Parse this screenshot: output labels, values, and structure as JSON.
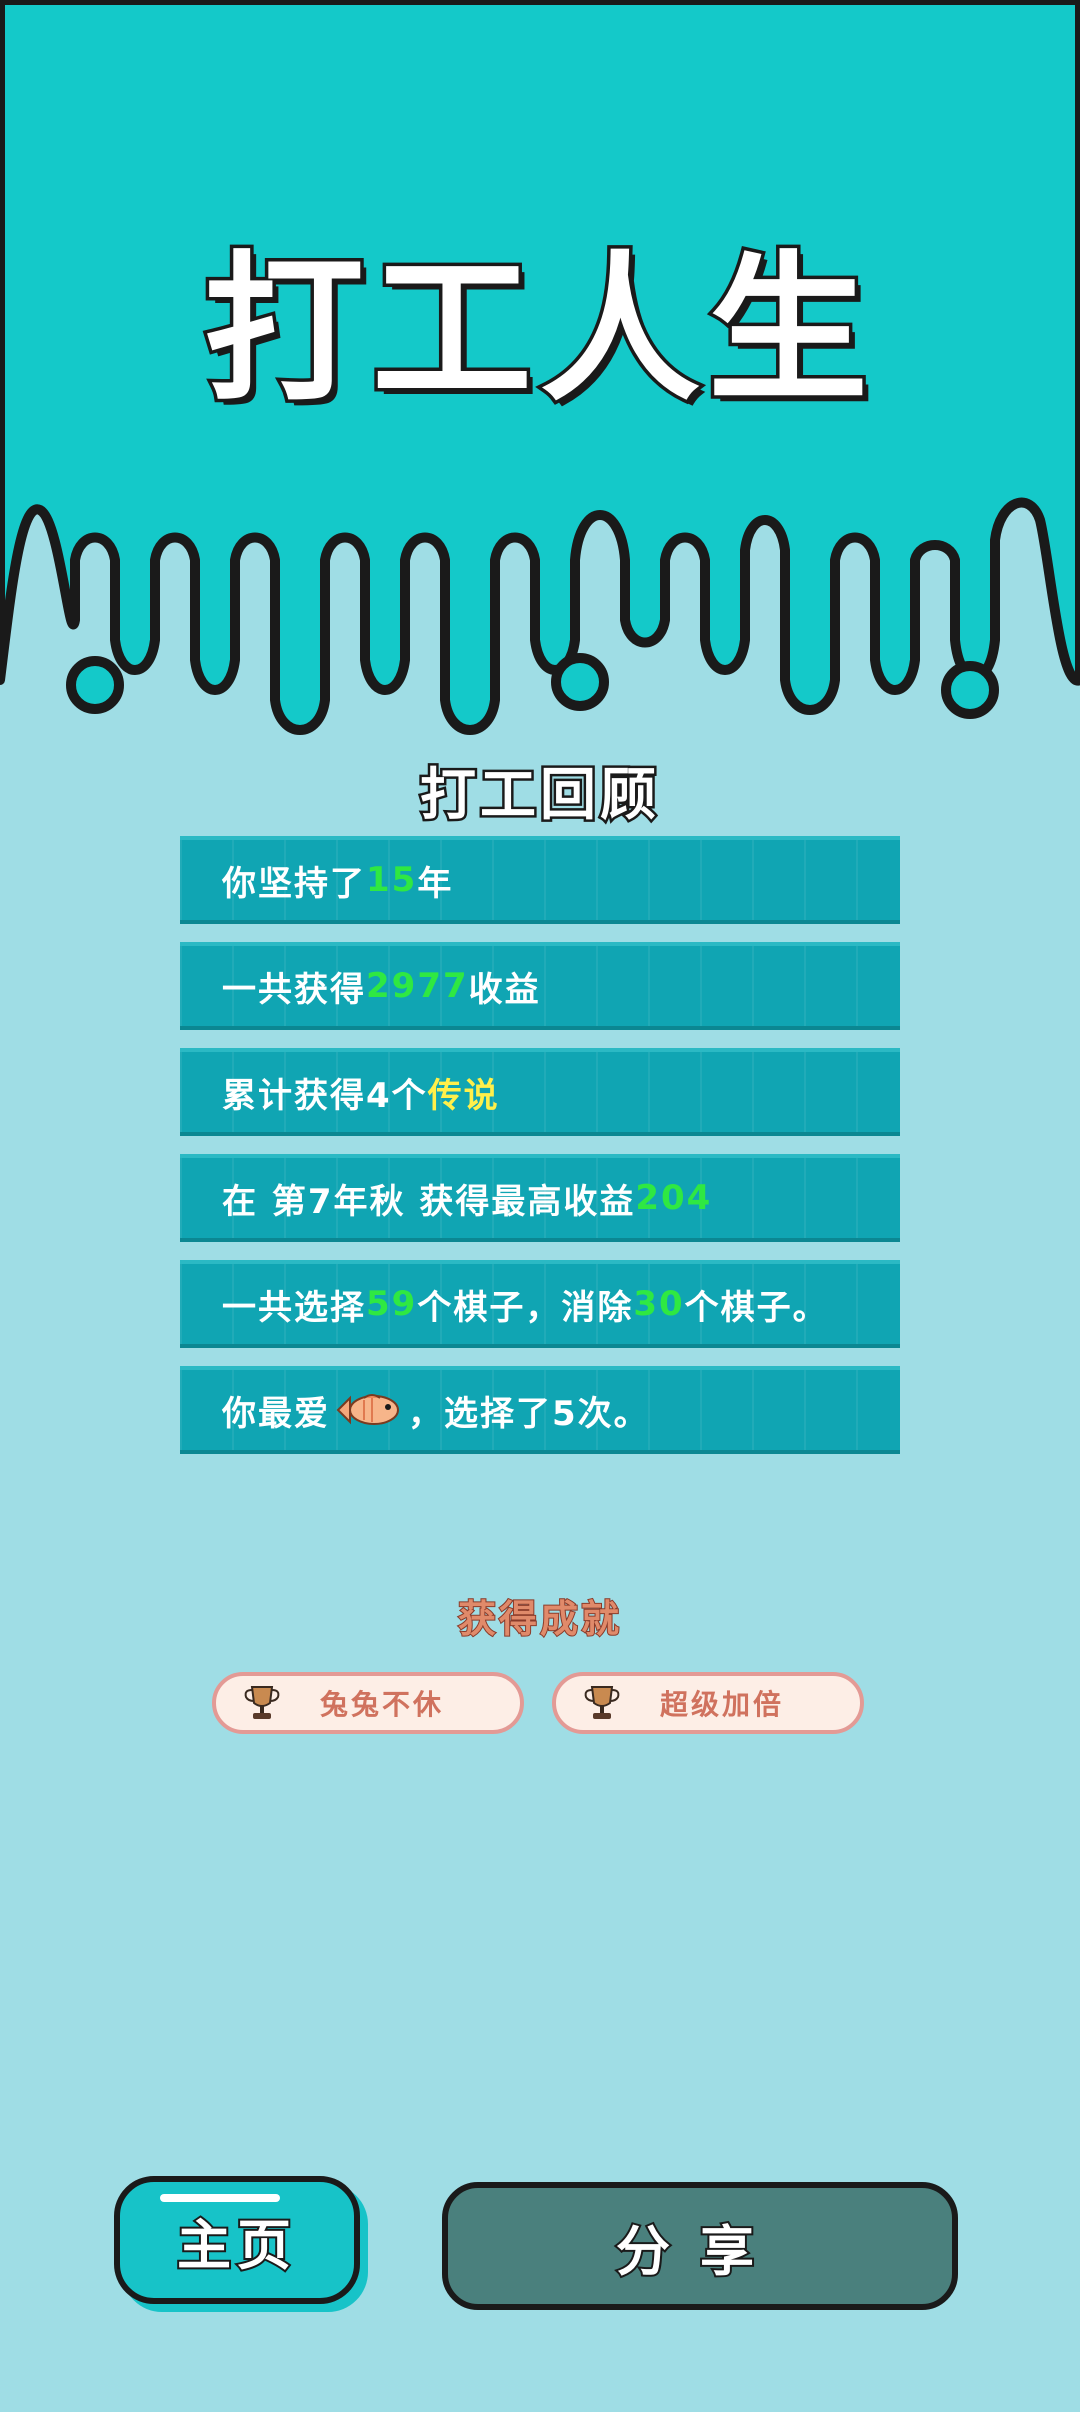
{
  "colors": {
    "top_bg": "#14c9c9",
    "page_bg": "#9fdde5",
    "row_bg": "#10a5b3",
    "highlight_green": "#2fe842",
    "highlight_yellow": "#fff04a",
    "badge_text": "#d0725e",
    "share_button": "#4a807d",
    "home_button": "#17c3c8"
  },
  "header": {
    "title": "打工人生"
  },
  "review": {
    "title": "打工回顾",
    "rows": [
      {
        "pre": "你坚持了",
        "hl": "15",
        "post": "年"
      },
      {
        "pre": "一共获得",
        "hl": "2977",
        "post": "收益"
      },
      {
        "pre": "累计获得4个",
        "hl": "传说",
        "post": ""
      },
      {
        "pre": "在 第7年秋 获得最高收益",
        "hl": "204",
        "post": ""
      },
      {
        "pre": "一共选择",
        "hl": "59",
        "mid": "个棋子，消除",
        "hl2": "30",
        "post": "个棋子。"
      },
      {
        "pre": "你最爱",
        "icon": "fish-icon",
        "post": "，选择了5次。"
      }
    ]
  },
  "achievements": {
    "title": "获得成就",
    "items": [
      {
        "label": "兔兔不休",
        "icon": "trophy-icon"
      },
      {
        "label": "超级加倍",
        "icon": "trophy-icon"
      }
    ]
  },
  "buttons": {
    "home_label": "主页",
    "share_label": "分享"
  }
}
